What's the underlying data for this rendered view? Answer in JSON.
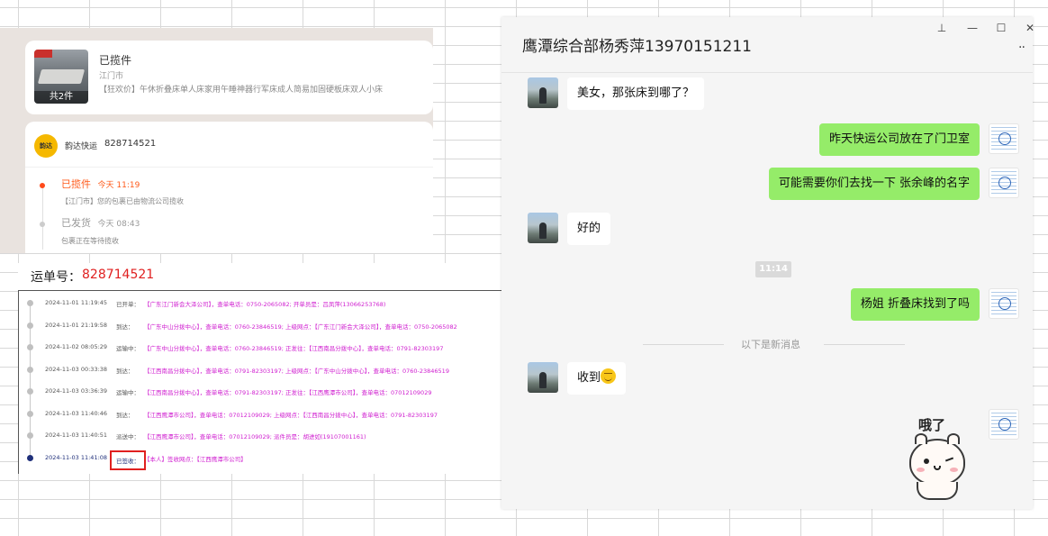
{
  "order": {
    "status": "已揽件",
    "city": "江门市",
    "product_title": "【狂欢价】午休折叠床单人床家用午睡神器行军床成人简易加固硬板床双人小床",
    "thumb_count": "共2件"
  },
  "logistics": {
    "courier_logo": "韵达",
    "courier_name": "韵达快运",
    "tracking_number": "828714521",
    "events": [
      {
        "status": "已揽件",
        "time": "今天 11:19",
        "desc": "【江门市】您的包裹已由物流公司揽收"
      },
      {
        "status": "已发货",
        "time": "今天 08:43",
        "desc": "包裹正在等待揽收"
      }
    ]
  },
  "waybill": {
    "label": "运单号：",
    "number": "828714521",
    "rows": [
      {
        "time": "2024-11-01 11:19:45",
        "action": "已开单：",
        "detail": "【广东江门新会大泽公司】，查单电话：0750-2065082;  开单员是：吕凤萍(13066253768)"
      },
      {
        "time": "2024-11-01 21:19:58",
        "action": "到达：",
        "detail": "【广东中山分拨中心】，查单电话：0760-23846519;  上级网点：【广东江门新会大泽公司】，查单电话：0750-2065082"
      },
      {
        "time": "2024-11-02 08:05:29",
        "action": "运输中：",
        "detail": "【广东中山分拨中心】，查单电话：0760-23846519;  正发往：【江西南昌分拨中心】，查单电话：0791-82303197"
      },
      {
        "time": "2024-11-03 00:33:38",
        "action": "到达：",
        "detail": "【江西南昌分拨中心】，查单电话：0791-82303197;  上级网点：【广东中山分拨中心】，查单电话：0760-23846519"
      },
      {
        "time": "2024-11-03 03:36:39",
        "action": "运输中：",
        "detail": "【江西南昌分拨中心】，查单电话：0791-82303197;  正发往：【江西鹰潭市公司】，查单电话：07012109029"
      },
      {
        "time": "2024-11-03 11:40:46",
        "action": "到达：",
        "detail": "【江西鹰潭市公司】，查单电话：07012109029;  上级网点：【江西南昌分拨中心】，查单电话：0791-82303197"
      },
      {
        "time": "2024-11-03 11:40:51",
        "action": "派送中：",
        "detail": "【江西鹰潭市公司】，查单电话：07012109029;  派件员是：胡进如(19107001161)"
      },
      {
        "time": "2024-11-03 11:41:08",
        "action": "已签收：",
        "detail": "【本人】签收网点：【江西鹰潭市公司】"
      }
    ]
  },
  "chat": {
    "title": "鹰潭综合部杨秀萍13970151211",
    "window_controls": {
      "pin": "⊥",
      "minimize": "—",
      "maximize": "☐",
      "close": "✕"
    },
    "more": "··",
    "messages": [
      {
        "side": "left",
        "text": "美女，那张床到哪了？"
      },
      {
        "side": "right",
        "text": "昨天快运公司放在了门卫室"
      },
      {
        "side": "right",
        "text": "可能需要你们去找一下  张余峰的名字"
      },
      {
        "side": "left",
        "text": "好的"
      },
      {
        "side": "right",
        "text": "杨姐 折叠床找到了吗"
      },
      {
        "side": "left",
        "text": "收到"
      }
    ],
    "time_separator": "11:14",
    "new_messages_label": "以下是新消息",
    "sticker_text": "哦了"
  },
  "colors": {
    "chat_bubble_self": "#95ec69",
    "highlight_red": "#e02020",
    "link_magenta": "#d020d0"
  }
}
